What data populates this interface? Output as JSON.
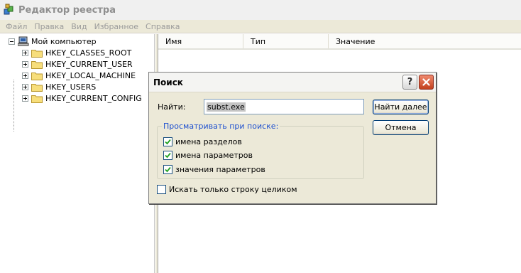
{
  "window": {
    "title": "Редактор реестра"
  },
  "menu": [
    "Файл",
    "Правка",
    "Вид",
    "Избранное",
    "Справка"
  ],
  "tree": {
    "root": "Мой компьютер",
    "children": [
      "HKEY_CLASSES_ROOT",
      "HKEY_CURRENT_USER",
      "HKEY_LOCAL_MACHINE",
      "HKEY_USERS",
      "HKEY_CURRENT_CONFIG"
    ]
  },
  "list": {
    "columns": [
      "Имя",
      "Тип",
      "Значение"
    ]
  },
  "dialog": {
    "title": "Поиск",
    "find_label": "Найти:",
    "find_value": "subst.exe",
    "find_next_button": "Найти далее",
    "cancel_button": "Отмена",
    "group_title": "Просматривать при поиске:",
    "options": [
      {
        "label": "имена разделов",
        "checked": true
      },
      {
        "label": "имена параметров",
        "checked": true
      },
      {
        "label": "значения параметров",
        "checked": true
      }
    ],
    "whole_string": {
      "label": "Искать только строку целиком",
      "checked": false
    },
    "help_glyph": "?"
  }
}
